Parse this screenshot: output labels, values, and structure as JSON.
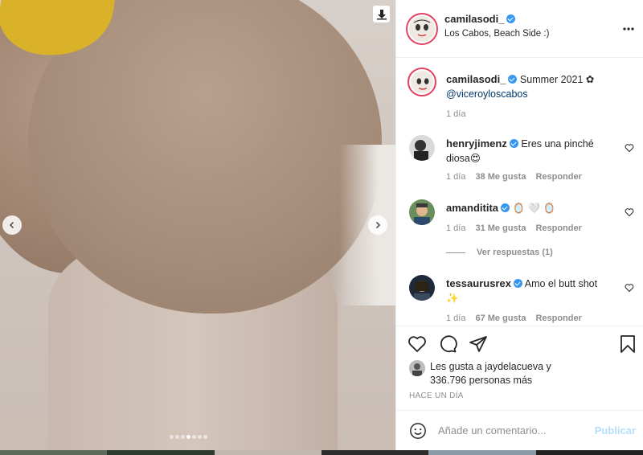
{
  "media": {
    "carousel_dots": 7,
    "active_dot_index": 3
  },
  "post": {
    "author": "camilasodi_",
    "location": "Los Cabos, Beach Side :)",
    "more_icon": "more-horizontal-icon"
  },
  "caption": {
    "author": "camilasodi_",
    "text": "Summer 2021",
    "mention": "@viceroyloscabos",
    "time": "1 día"
  },
  "comments": [
    {
      "user": "henryjimenz",
      "text_line1": "Eres una pinché",
      "text_line2": "diosa😍",
      "time": "1 día",
      "likes": "38 Me gusta",
      "reply": "Responder"
    },
    {
      "user": "amanditita",
      "text": "🪞 🤍 🪞",
      "time": "1 día",
      "likes": "31 Me gusta",
      "reply": "Responder"
    },
    {
      "user": "tessaurusrex",
      "text_line1": "Amo el butt shot",
      "text_line2": "✨",
      "time": "1 día",
      "likes": "67 Me gusta",
      "reply": "Responder"
    }
  ],
  "view_replies": "Ver respuestas (1)",
  "likes_line1": "Les gusta a jaydelacueva y",
  "likes_line2": "336.796 personas más",
  "time_ago": "HACE UN DÍA",
  "comment_input": {
    "placeholder": "Añade un comentario..."
  },
  "publish_label": "Publicar",
  "colors": {
    "verified": "#3897f0",
    "link": "#00376b",
    "muted": "#8e8e8e",
    "publish_disabled": "#b2dffc"
  }
}
